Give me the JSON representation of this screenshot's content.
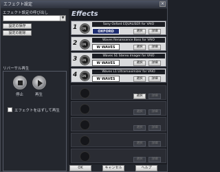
{
  "window": {
    "title": "エフェクト設定"
  },
  "left": {
    "preset_label": "エフェクト設定の呼び出し",
    "preset_value": "",
    "save_button": "設定の保存",
    "delete_button": "設定の削除",
    "reverb_label": "リバーサル再生",
    "stop_label": "停止",
    "play_label": "再生",
    "checkbox_label": "エフェクトをはずして再生"
  },
  "effects": {
    "title": "Effects",
    "slots": [
      {
        "num": "1",
        "name": "Sony Oxford EQUALISER for VAIO",
        "logo": "OXFORD",
        "logo_type": "oxford",
        "select": "選択",
        "detail": "詳細"
      },
      {
        "num": "2",
        "name": "Waves Renaissance Bass for VAIO",
        "logo": "W WAVES",
        "logo_type": "waves",
        "select": "選択",
        "detail": "詳細"
      },
      {
        "num": "3",
        "name": "Waves S1 Stereo Imager for VAIO",
        "logo": "W WAVES",
        "logo_type": "waves",
        "select": "選択",
        "detail": "詳細"
      },
      {
        "num": "4",
        "name": "Waves L1 Ultramaximizer for VAIO",
        "logo": "W WAVES",
        "logo_type": "waves",
        "select": "選択",
        "detail": "詳細"
      }
    ],
    "empty_select": "選択",
    "empty_detail": "詳細"
  },
  "footer": {
    "ok": "OK",
    "cancel": "キャンセル",
    "help": "ヘルプ"
  }
}
